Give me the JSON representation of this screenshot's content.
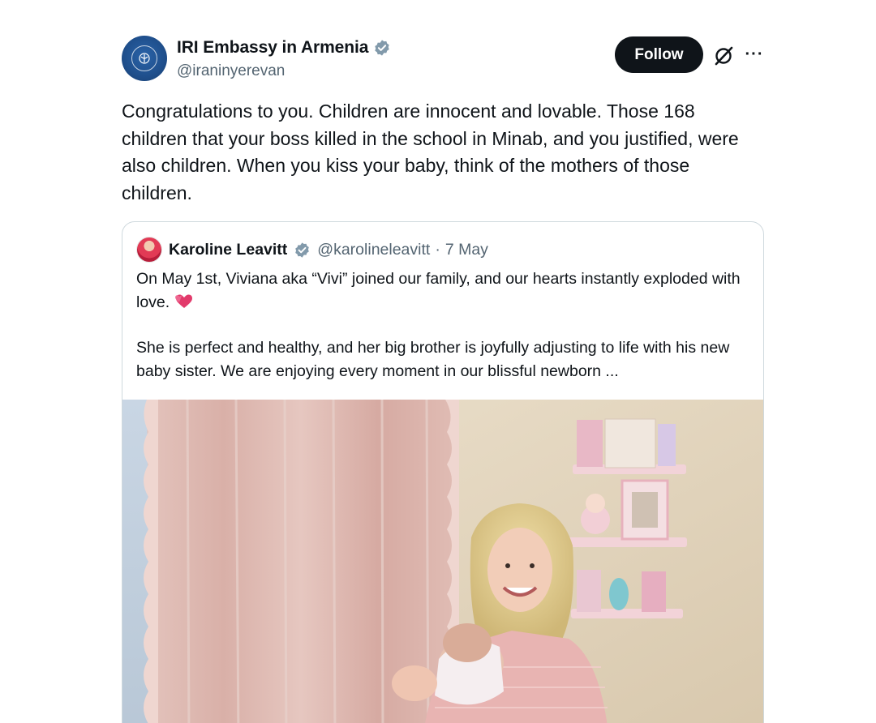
{
  "tweet": {
    "display_name": "IRI Embassy in Armenia",
    "handle": "@iraninyerevan",
    "follow_label": "Follow",
    "more_label": "···",
    "text": "Congratulations to you. Children are innocent and lovable. Those 168 children that your boss killed in the school in Minab, and you justified, were also children. When you kiss your baby, think of the mothers of those children.",
    "avatar_icon": "embassy-emblem-icon",
    "verified_color": "#829aab"
  },
  "quote": {
    "display_name": "Karoline Leavitt",
    "handle": "@karolineleavitt",
    "separator": "·",
    "date": "7 May",
    "para1": "On May 1st, Viviana aka “Vivi” joined our family, and our hearts instantly exploded with love.",
    "para2": "She is perfect and healthy, and her big brother is joyfully adjusting to life with his new baby sister. We are enjoying every moment in our blissful newborn ...",
    "emoji": "two-hearts-icon",
    "verified_color": "#829aab"
  },
  "colors": {
    "text": "#0f1419",
    "secondary": "#536471",
    "border": "#cfd9de",
    "follow_bg": "#0f1419"
  }
}
